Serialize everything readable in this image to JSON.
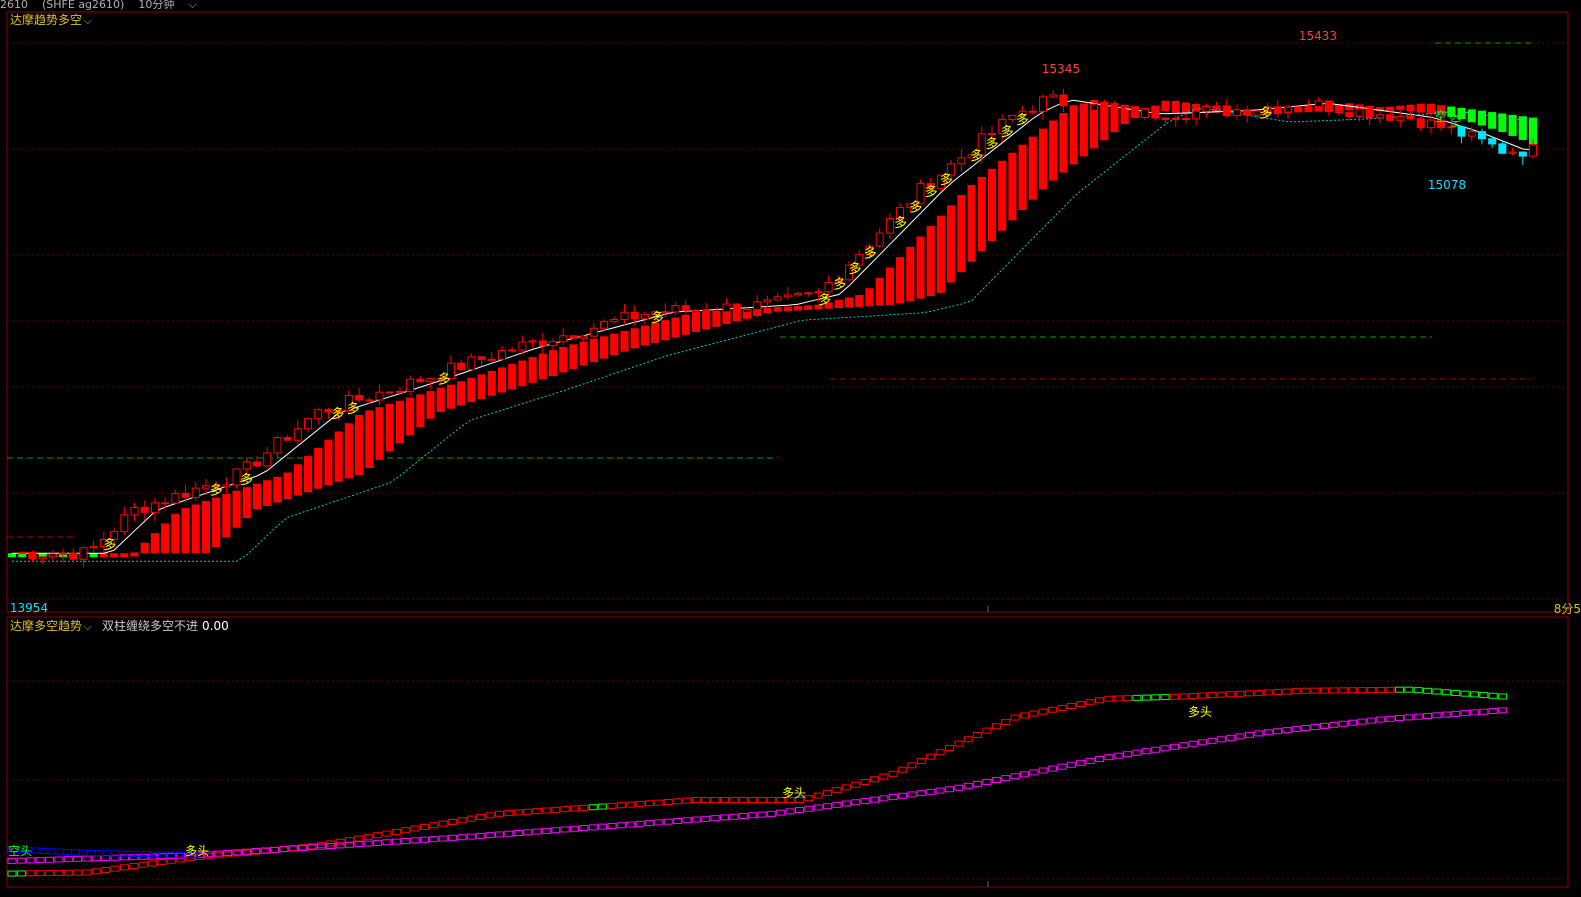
{
  "toolbar": {
    "contract": "2610",
    "symbol": "(SHFE ag2610)",
    "period": "10分钟"
  },
  "main_panel": {
    "title": "达摩趋势多空",
    "bottom_right_label": "8分5"
  },
  "sub_panel": {
    "title": "达摩多空趋势",
    "indicator_name": "双柱缠绕多空不进",
    "indicator_value": "0.00"
  },
  "colors": {
    "up": "#ff0000",
    "down": "#00e5ff",
    "bull_band": "#ff0000",
    "bear_band": "#00ff00",
    "grid": "#7a0000",
    "signal": "#ffff00",
    "magenta": "#ff00ff",
    "blue": "#0000ff",
    "green_label": "#00ff00"
  },
  "chart_data": [
    {
      "type": "candlestick",
      "title": "达摩趋势多空",
      "annotations": [
        {
          "text": "15345",
          "kind": "high"
        },
        {
          "text": "15433",
          "kind": "high"
        },
        {
          "text": "15078",
          "kind": "low"
        },
        {
          "text": "13954",
          "kind": "low"
        }
      ],
      "signal_labels": {
        "bull": "多",
        "bear": "空"
      },
      "ylim": [
        13900,
        15500
      ],
      "price_path": [
        [
          0,
          14030
        ],
        [
          0.05,
          14030
        ],
        [
          0.08,
          14150
        ],
        [
          0.15,
          14250
        ],
        [
          0.2,
          14420
        ],
        [
          0.26,
          14500
        ],
        [
          0.33,
          14600
        ],
        [
          0.42,
          14700
        ],
        [
          0.5,
          14720
        ],
        [
          0.53,
          14750
        ],
        [
          0.6,
          15050
        ],
        [
          0.66,
          15250
        ],
        [
          0.68,
          15290
        ],
        [
          0.74,
          15250
        ],
        [
          0.8,
          15260
        ],
        [
          0.85,
          15280
        ],
        [
          0.92,
          15240
        ],
        [
          0.95,
          15200
        ],
        [
          0.98,
          15150
        ]
      ]
    },
    {
      "type": "line",
      "title": "达摩多空趋势",
      "series": [
        {
          "color": "#ff0000",
          "x": [
            0,
            0.05,
            0.12,
            0.2,
            0.32,
            0.45,
            0.52,
            0.58,
            0.66,
            0.72,
            0.77,
            0.85,
            0.92,
            0.98
          ],
          "values": [
            6,
            7,
            20,
            30,
            58,
            70,
            70,
            93,
            142,
            158,
            160,
            165,
            166,
            160
          ]
        },
        {
          "color": "#ff00ff",
          "x": [
            0,
            0.12,
            0.3,
            0.5,
            0.62,
            0.72,
            0.82,
            0.9,
            0.98
          ],
          "values": [
            17,
            22,
            38,
            58,
            80,
            107,
            128,
            140,
            148
          ]
        },
        {
          "color": "#0000ff",
          "x": [
            0,
            0.05,
            0.12
          ],
          "values": [
            27,
            24,
            22
          ]
        }
      ],
      "labels": [
        {
          "text": "空头",
          "series": 2
        },
        {
          "text": "多头",
          "series": 1
        },
        {
          "text": "多头",
          "series": 1
        },
        {
          "text": "多头",
          "series": 1
        }
      ],
      "ylim": [
        0,
        200
      ]
    }
  ]
}
